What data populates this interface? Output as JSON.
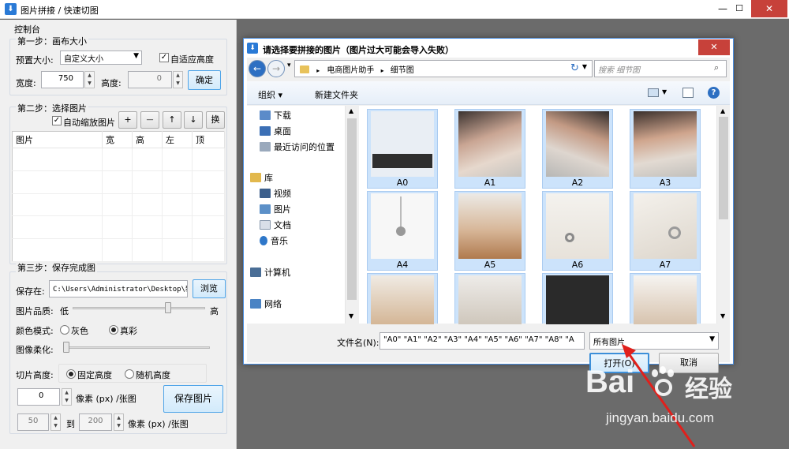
{
  "window": {
    "title": "图片拼接 / 快速切图",
    "minimize": "—",
    "maximize": "☐",
    "close": "✕"
  },
  "panel": {
    "title": "控制台",
    "step1": {
      "title": "第一步：画布大小",
      "preset_label": "预置大小:",
      "preset_value": "自定义大小",
      "auto_height_label": "自适应高度",
      "auto_height_checked": true,
      "width_label": "宽度:",
      "width_value": "750",
      "height_label": "高度:",
      "height_value": "0",
      "confirm_label": "确定"
    },
    "step2": {
      "title": "第二步：选择图片",
      "auto_scale_label": "自动缩放图片",
      "auto_scale_checked": true,
      "btn_add": "+",
      "btn_remove": "—",
      "btn_up": "↑",
      "btn_down": "↓",
      "btn_swap": "换",
      "columns": [
        "图片",
        "宽",
        "高",
        "左",
        "顶"
      ],
      "rows": 5
    },
    "step3": {
      "title": "第三步：保存完成图",
      "save_label": "保存在:",
      "save_path": "C:\\Users\\Administrator\\Desktop\\新",
      "browse_label": "浏览",
      "quality_label": "图片品质:",
      "quality_low": "低",
      "quality_high": "高",
      "quality_value_pct": 73,
      "color_label": "颜色模式:",
      "color_options": [
        "灰色",
        "真彩"
      ],
      "color_selected": "真彩",
      "soften_label": "图像柔化:",
      "soften_value_pct": 0,
      "slice_label": "切片高度:",
      "slice_options": [
        "固定高度",
        "随机高度"
      ],
      "slice_selected": "固定高度",
      "fixed_value": "0",
      "unit_label": "像素 (px) /张图",
      "save_btn": "保存图片",
      "range_from": "50",
      "range_to_label": "到",
      "range_to": "200",
      "range_unit": "像素 (px) /张图"
    }
  },
  "dialog": {
    "title": "请选择要拼接的图片（图片过大可能会导入失败）",
    "close": "✕",
    "breadcrumb": [
      "电商图片助手",
      "细节图"
    ],
    "search_placeholder": "搜索 细节图",
    "organize": "组织 ▾",
    "new_folder": "新建文件夹",
    "nav_items": [
      {
        "label": "下载",
        "icon": "download-folder-icon"
      },
      {
        "label": "桌面",
        "icon": "desktop-icon"
      },
      {
        "label": "最近访问的位置",
        "icon": "recent-places-icon"
      },
      {
        "label": "库",
        "icon": "library-icon"
      },
      {
        "label": "视频",
        "icon": "video-library-icon"
      },
      {
        "label": "图片",
        "icon": "pictures-library-icon"
      },
      {
        "label": "文档",
        "icon": "documents-library-icon"
      },
      {
        "label": "音乐",
        "icon": "music-library-icon"
      },
      {
        "label": "计算机",
        "icon": "computer-icon"
      },
      {
        "label": "网络",
        "icon": "network-icon"
      }
    ],
    "files": [
      "A0",
      "A1",
      "A2",
      "A3",
      "A4",
      "A5",
      "A6",
      "A7",
      "",
      "",
      "",
      ""
    ],
    "filename_label": "文件名(N):",
    "filename_value": "\"A0\" \"A1\" \"A2\" \"A3\" \"A4\" \"A5\" \"A6\" \"A7\" \"A8\" \"A",
    "filetype_value": "所有图片",
    "open_label": "打开(O)",
    "cancel_label": "取消"
  },
  "watermark": {
    "brand": "Bai",
    "brand_cn": "经验",
    "url": "jingyan.baidu.com"
  },
  "colors": {
    "accent": "#2a7ad6",
    "close_red": "#c7413a",
    "selection": "#cce3fb",
    "arrow_red": "#e0201c"
  }
}
